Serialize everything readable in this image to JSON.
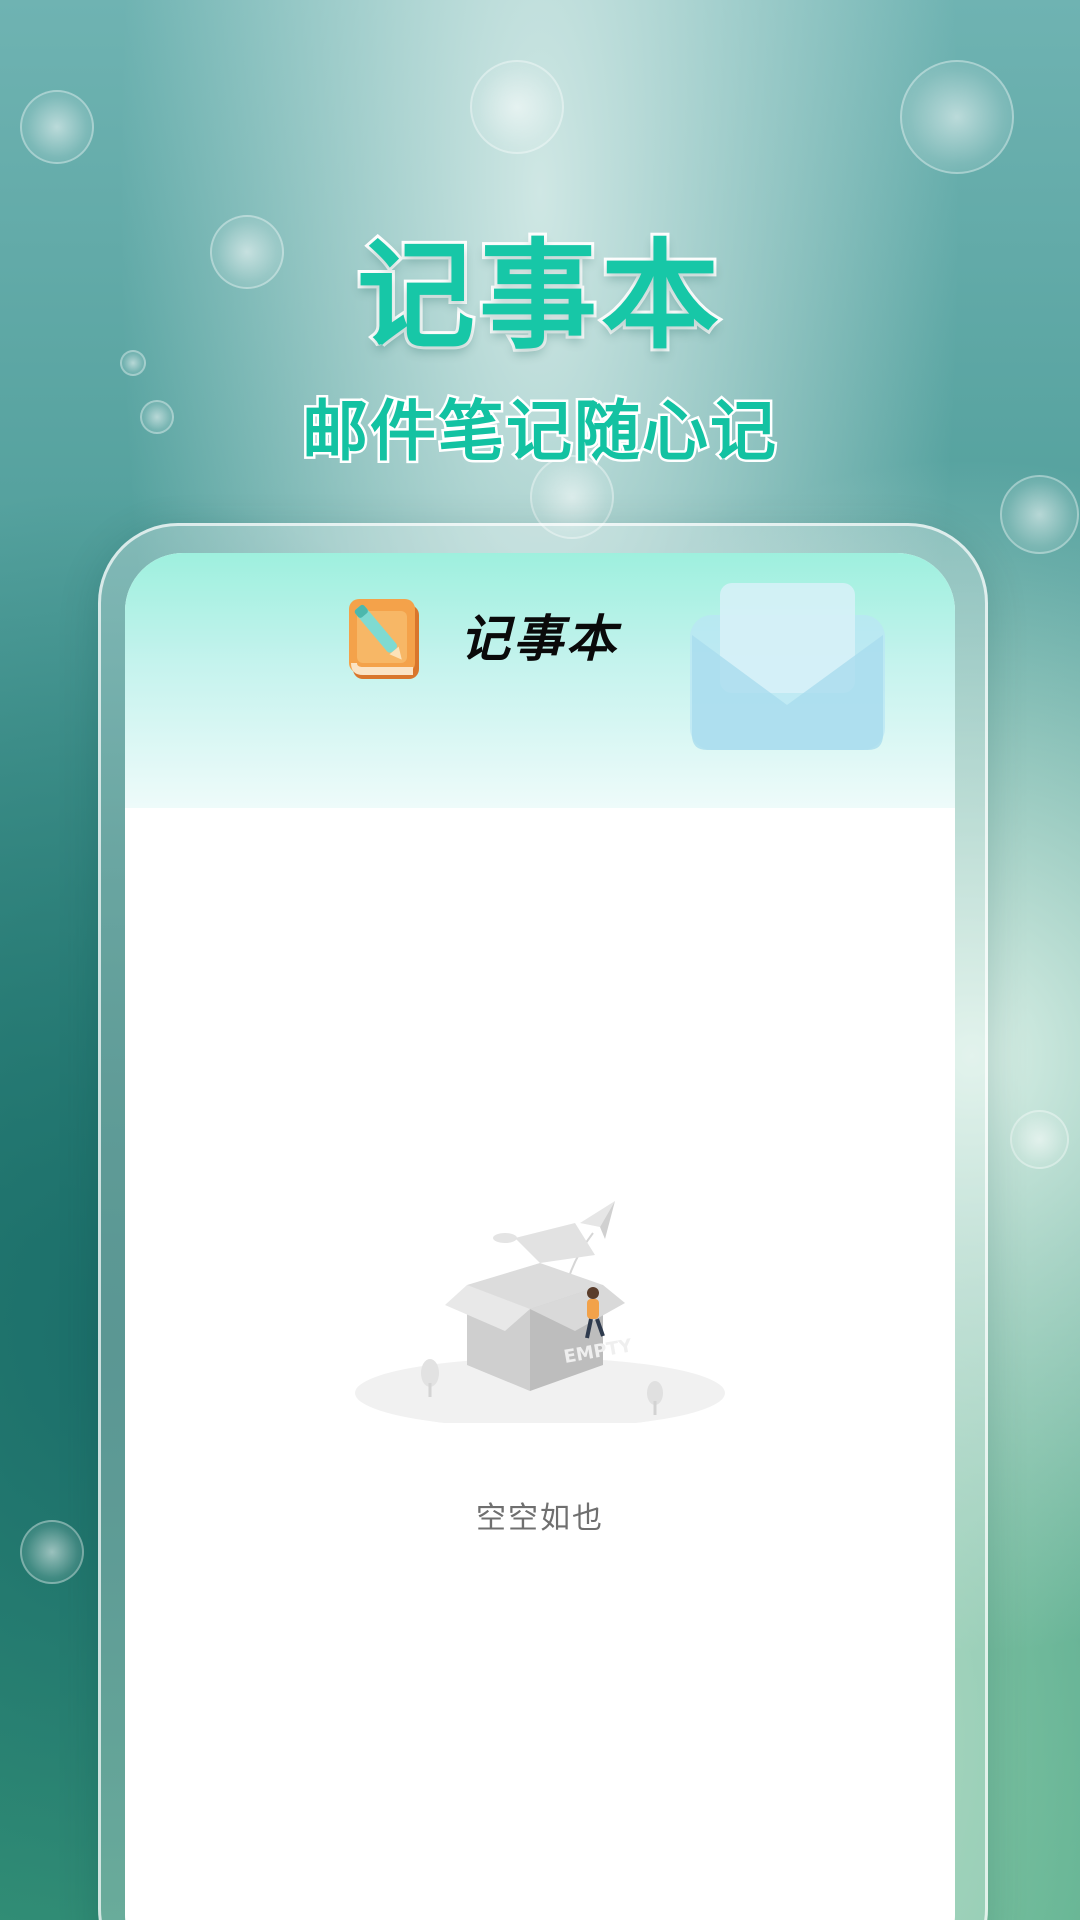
{
  "hero": {
    "title": "记事本",
    "subtitle": "邮件笔记随心记"
  },
  "app": {
    "header_title": "记事本",
    "logo_icon": "notebook-pencil-icon",
    "header_decoration_icon": "envelope-icon"
  },
  "empty_state": {
    "illustration_icon": "empty-box-icon",
    "illustration_label": "EMPTY",
    "message": "空空如也"
  },
  "colors": {
    "accent": "#17c7a7",
    "header_gradient_top": "#9ef0de",
    "empty_text": "#6f6f6f"
  }
}
